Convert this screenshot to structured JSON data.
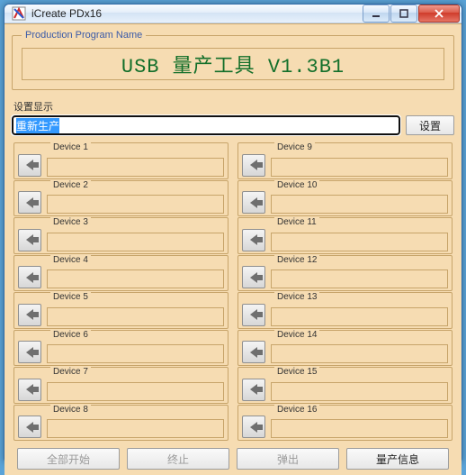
{
  "window": {
    "title": "iCreate PDx16"
  },
  "program": {
    "legend": "Production Program Name",
    "name": "USB 量产工具 V1.3B1"
  },
  "setting": {
    "label": "设置显示",
    "value": "重新生产",
    "button": "设置"
  },
  "devices": {
    "left": [
      "Device 1",
      "Device 2",
      "Device 3",
      "Device 4",
      "Device 5",
      "Device 6",
      "Device 7",
      "Device 8"
    ],
    "right": [
      "Device 9",
      "Device 10",
      "Device 11",
      "Device 12",
      "Device 13",
      "Device 14",
      "Device 15",
      "Device 16"
    ]
  },
  "buttons": {
    "start_all": "全部开始",
    "stop": "终止",
    "eject": "弹出",
    "info": "量产信息"
  },
  "colors": {
    "accent_green": "#136f2a",
    "panel_bg": "#f6dcb2"
  }
}
